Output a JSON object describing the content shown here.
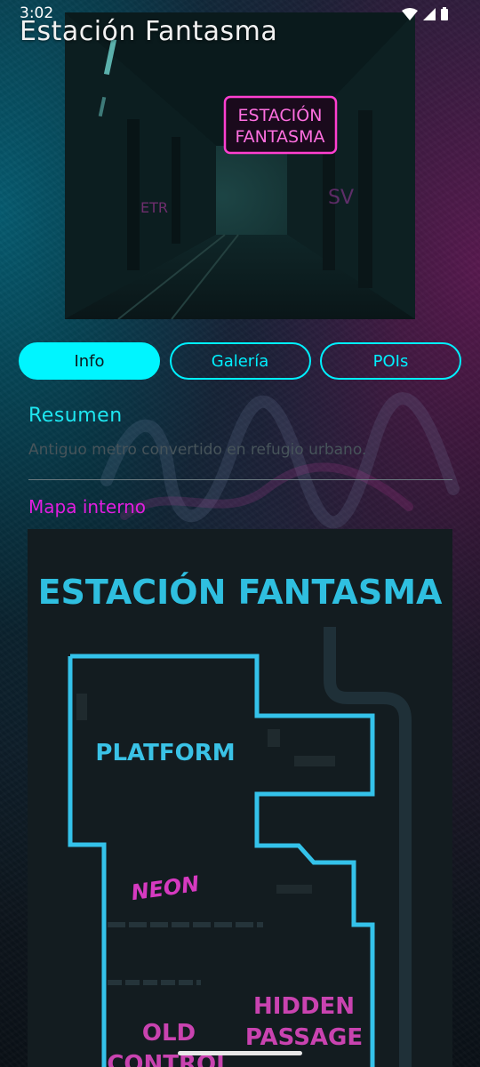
{
  "status_bar": {
    "time": "3:02",
    "icons": [
      "wifi-icon",
      "signal-icon",
      "battery-icon"
    ]
  },
  "header": {
    "title": "Estación Fantasma"
  },
  "hero": {
    "neon_sign_line1": "ESTACIÓN",
    "neon_sign_line2": "FANTASMA"
  },
  "tabs": [
    {
      "label": "Info",
      "active": true
    },
    {
      "label": "Galería",
      "active": false
    },
    {
      "label": "POIs",
      "active": false
    }
  ],
  "summary": {
    "heading": "Resumen",
    "text": "Antiguo metro convertido en refugio urbano."
  },
  "map_section": {
    "heading": "Mapa interno",
    "map_title": "ESTACIÓN FANTASMA",
    "labels": {
      "platform": "PLATFORM",
      "neon": "NEON",
      "hidden_line1": "HIDDEN",
      "hidden_line2": "PASSAGE",
      "old_line1": "OLD",
      "old_line2": "CONTROL"
    }
  },
  "colors": {
    "accent_cyan": "#00f0ff",
    "accent_magenta": "#e21de0",
    "map_line": "#2fb9dd",
    "map_magenta": "#e040c8"
  }
}
